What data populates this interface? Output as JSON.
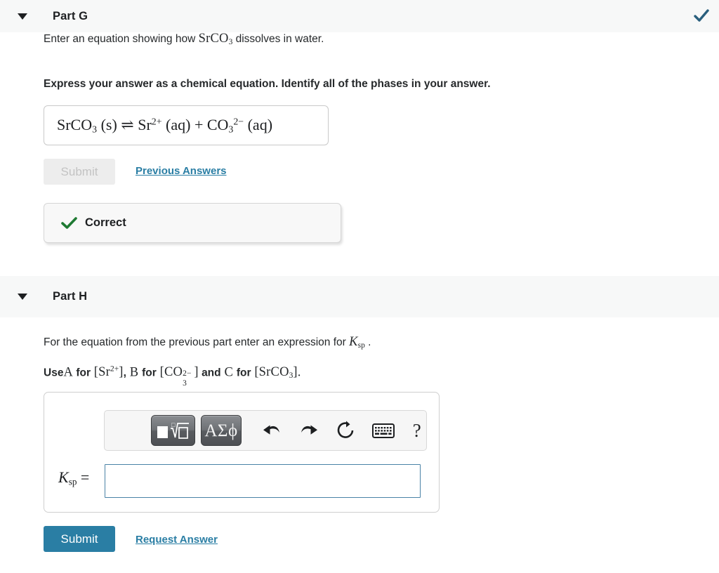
{
  "colors": {
    "header_band": "#f7f8f8",
    "link": "#2a7ea4",
    "primary_button": "#2a7ea4",
    "correct_check": "#1f7a33",
    "header_check": "#2a5f7d",
    "input_border": "#4a82a6"
  },
  "partG": {
    "caret_icon": "caret-down-icon",
    "title": "Part G",
    "status_icon": "check-icon",
    "prompt_pre": "Enter an equation showing how ",
    "prompt_formula": "SrCO3",
    "prompt_post": " dissolves in water.",
    "instruction": "Express your answer as a chemical equation. Identify all of the phases in your answer.",
    "answer_equation": "SrCO3 (s) ⇌ Sr2+ (aq) + CO3 2- (aq)",
    "submit_label": "Submit",
    "submit_state": "disabled",
    "previous_answers_label": "Previous Answers",
    "feedback_icon": "check-icon",
    "feedback_label": "Correct"
  },
  "partH": {
    "caret_icon": "caret-down-icon",
    "title": "Part H",
    "prompt_pre": "For the equation from the previous part enter an expression for ",
    "prompt_symbol": "Ksp",
    "prompt_post": ".",
    "instruction_parts": {
      "use": "Use",
      "a": "A",
      "for1": "for",
      "sr": "[Sr2+]",
      "comma": ",",
      "b": "B",
      "for2": "for",
      "co3": "[CO3 2-]",
      "and": "and",
      "c": "C",
      "for3": "for",
      "srco3": "[SrCO3]",
      "period": "."
    },
    "toolbar": [
      {
        "name": "template-sqrt-button",
        "label": "■√□",
        "kind": "raised"
      },
      {
        "name": "greek-symbols-button",
        "label": "ΑΣϕ",
        "kind": "raised"
      },
      {
        "name": "undo-button",
        "label": "undo-arrow-icon",
        "kind": "flat"
      },
      {
        "name": "redo-button",
        "label": "redo-arrow-icon",
        "kind": "flat"
      },
      {
        "name": "reset-button",
        "label": "reset-circular-arrow-icon",
        "kind": "flat"
      },
      {
        "name": "keyboard-button",
        "label": "keyboard-icon",
        "kind": "flat"
      },
      {
        "name": "help-button",
        "label": "?",
        "kind": "flat"
      }
    ],
    "field_label": "Ksp =",
    "field_value": "",
    "field_placeholder": "",
    "submit_label": "Submit",
    "submit_state": "enabled",
    "request_answer_label": "Request Answer"
  }
}
